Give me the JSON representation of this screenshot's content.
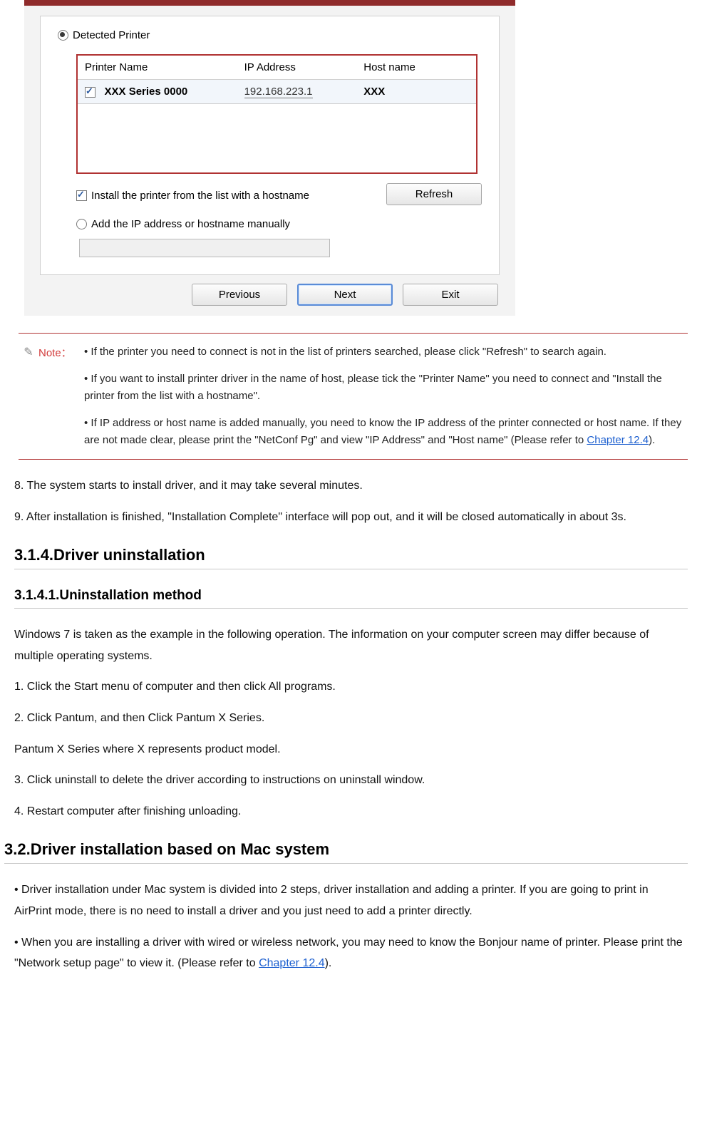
{
  "dialog": {
    "detectedLabel": "Detected Printer",
    "table": {
      "headers": {
        "name": "Printer Name",
        "ip": "IP Address",
        "host": "Host name"
      },
      "row": {
        "name": "XXX  Series 0000",
        "ip": "192.168.223.1",
        "host": "XXX"
      }
    },
    "installHostnameLabel": "Install the printer from the list with a hostname",
    "manualLabel": "Add the IP address or hostname manually",
    "refreshLabel": "Refresh",
    "prevLabel": "Previous",
    "nextLabel": "Next",
    "exitLabel": "Exit"
  },
  "note": {
    "label": "Note：",
    "p1": "• If the printer you need to connect is not in the list of printers searched, please click \"Refresh\" to search again.",
    "p2": "• If you want to install printer driver in the name of host, please tick the \"Printer Name\" you need to connect and \"Install the printer from the list with a hostname\".",
    "p3a": "• If IP address or host name is added manually, you need to know the IP address of the printer connected or host name. If they are not made clear, please print the \"NetConf Pg\" and view \"IP Address\" and \"Host name\" (Please refer to ",
    "p3link": "Chapter 12.4",
    "p3b": ")."
  },
  "article": {
    "step8": "8. The system starts to install driver, and it may take several minutes.",
    "step9": "9. After installation is finished, \"Installation Complete\" interface will pop out, and it will be closed automatically in about 3s.",
    "h314": "3.1.4.Driver uninstallation",
    "h3141": "3.1.4.1.Uninstallation method",
    "u_intro": "Windows 7 is taken as the example in the following operation. The information on your computer screen may differ because of multiple operating systems.",
    "u1": "1. Click the Start menu of computer and then click All programs.",
    "u2": "2. Click Pantum, and then Click Pantum X Series.",
    "u2b": "Pantum X Series where X represents product model.",
    "u3": "3. Click uninstall to delete the driver according to instructions on uninstall window.",
    "u4": "4. Restart computer after finishing unloading.",
    "h32": "3.2.Driver installation based on Mac system",
    "m1": "• Driver installation under Mac system is divided into 2 steps, driver installation and adding a printer. If you are going to print in AirPrint mode, there is no need to install a driver and you just need to add a printer directly.",
    "m2a": "• When you are installing a driver with wired or wireless network, you may need to know the Bonjour name of printer. Please print the \"Network setup page\" to view it. (Please refer to ",
    "m2link": "Chapter 12.4",
    "m2b": ")."
  }
}
